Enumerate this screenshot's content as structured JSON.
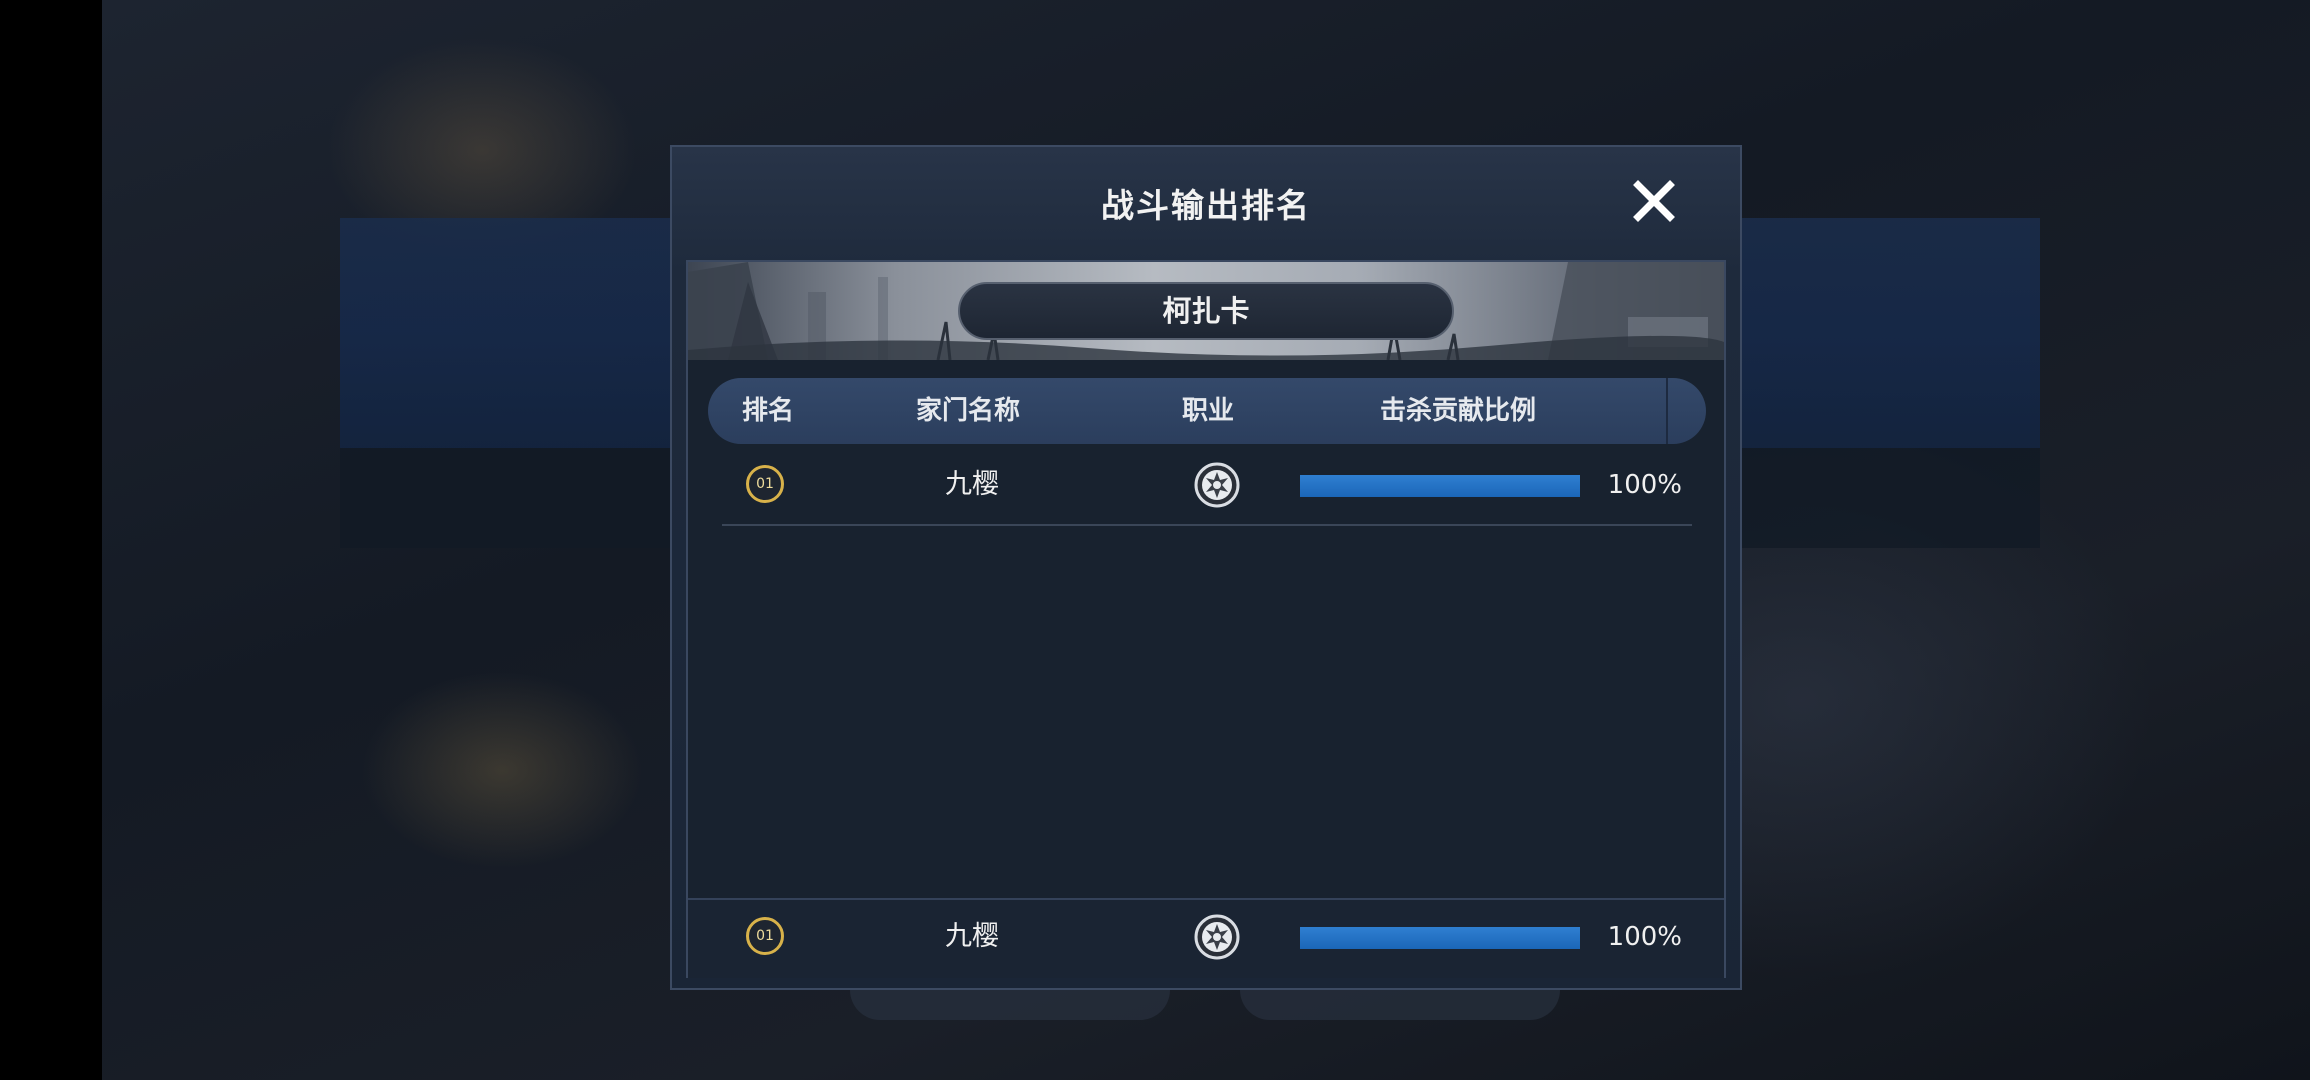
{
  "dialog": {
    "title": "战斗输出排名",
    "banner_name": "柯扎卡"
  },
  "table": {
    "headers": [
      "排名",
      "家门名称",
      "职业",
      "击杀贡献比例"
    ],
    "rows": [
      {
        "rank": "01",
        "name": "九樱",
        "class_icon": "class-emblem-icon",
        "percent": "100%",
        "fill": 1.0
      }
    ]
  },
  "self_row": {
    "rank": "01",
    "name": "九樱",
    "class_icon": "class-emblem-icon",
    "percent": "100%",
    "fill": 1.0
  },
  "colors": {
    "accent_gold": "#d8b24a",
    "bar_blue": "#1b66b8"
  }
}
